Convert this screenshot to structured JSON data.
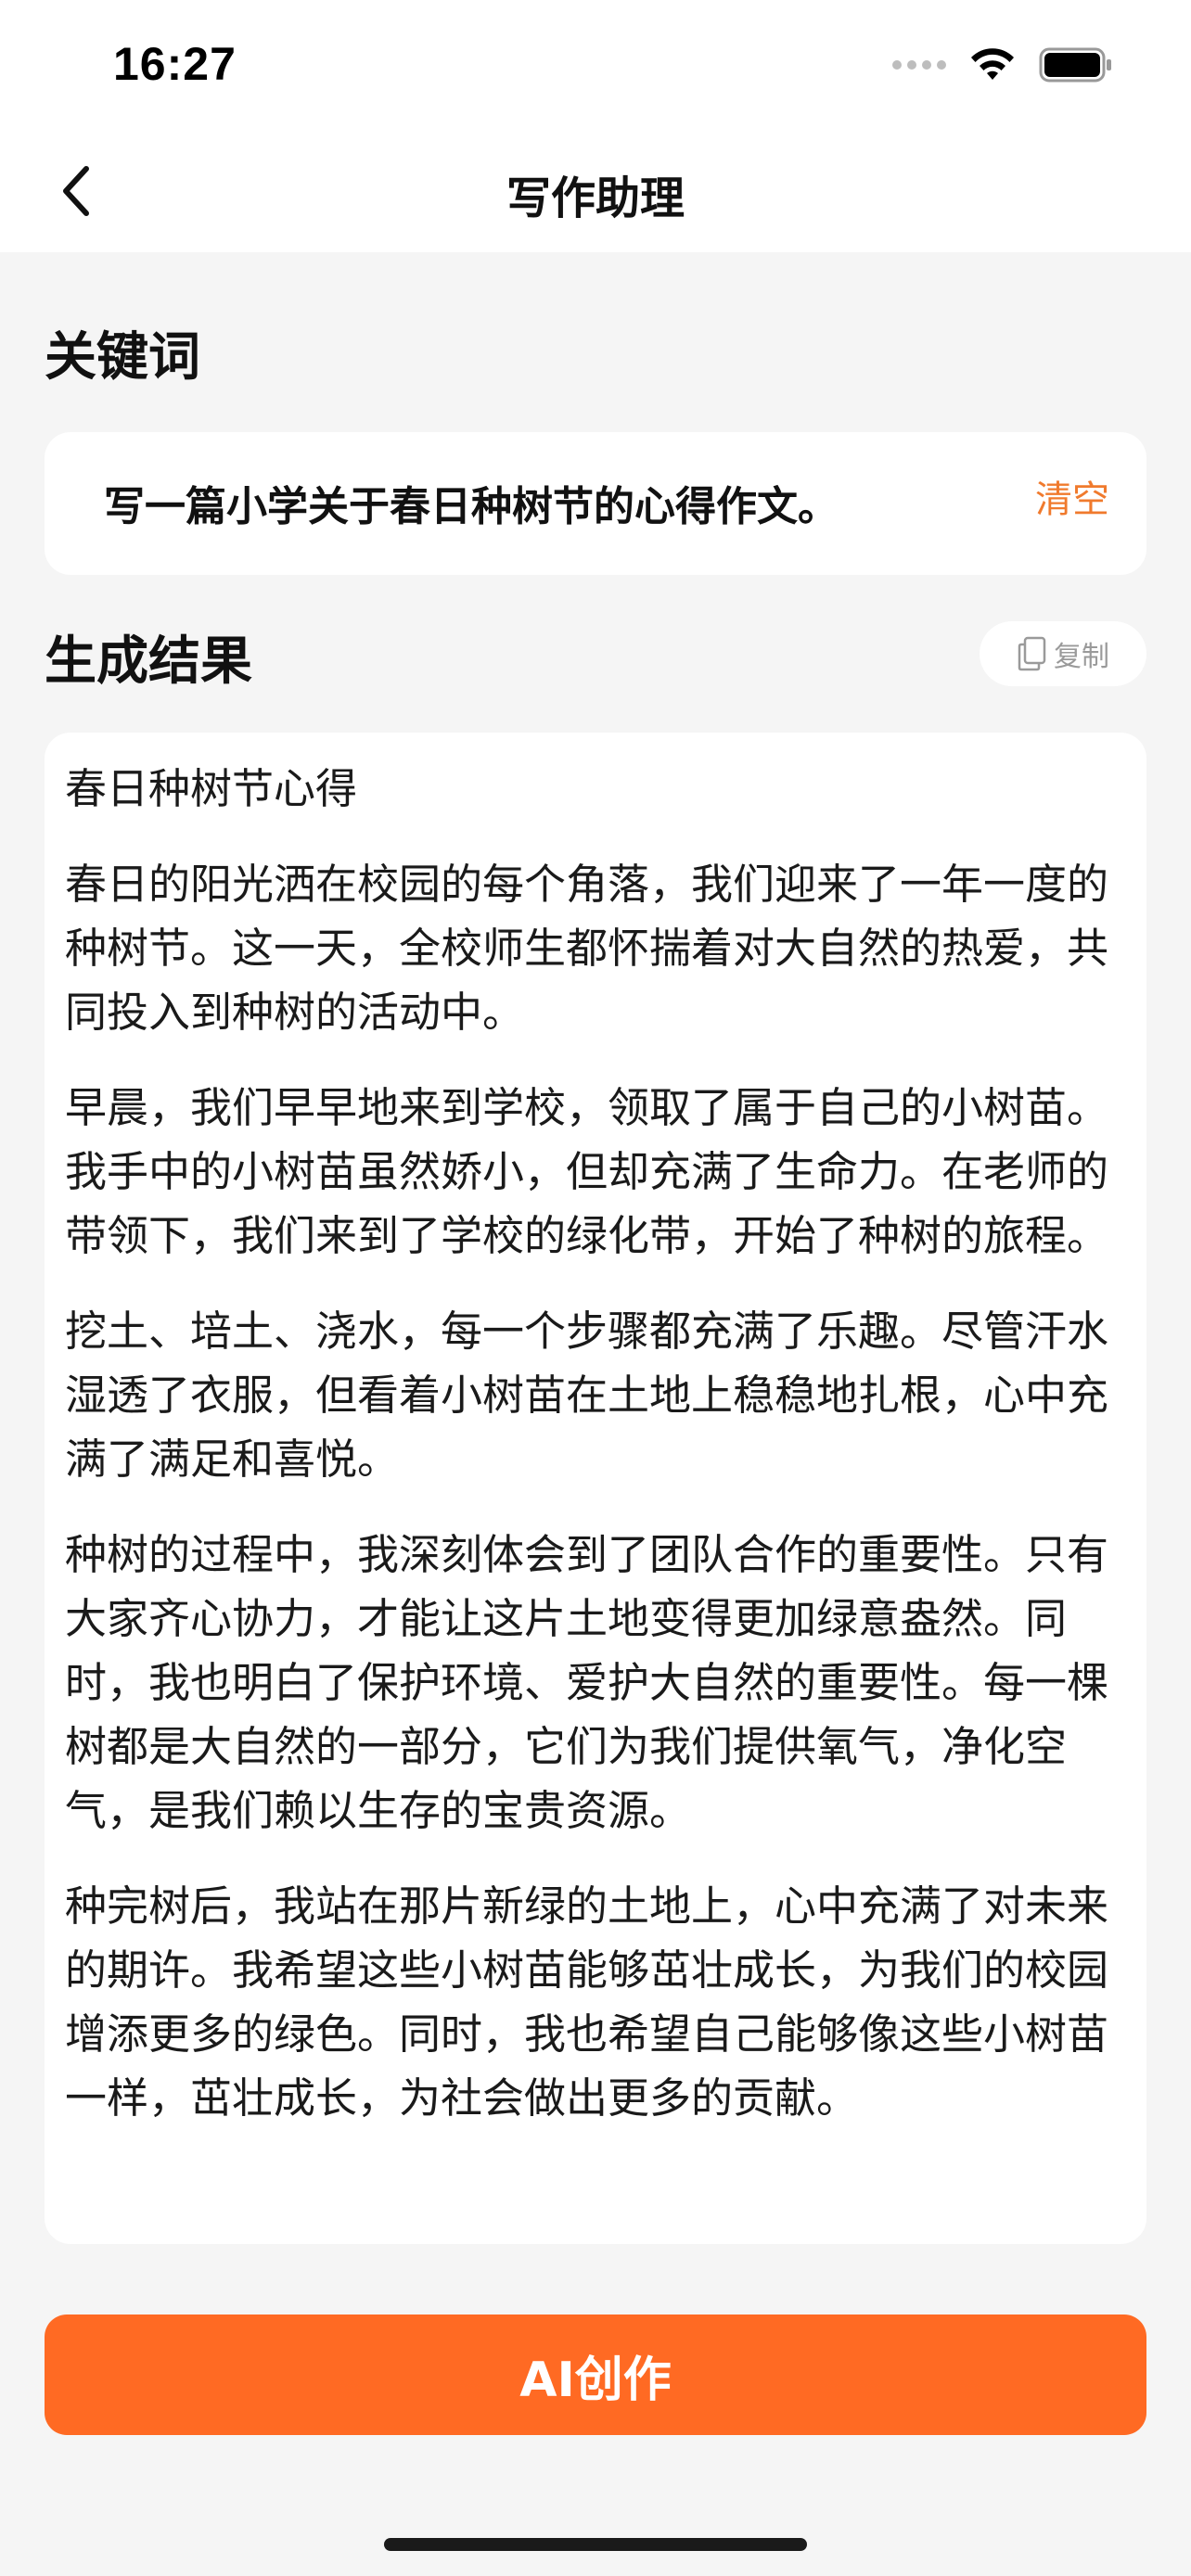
{
  "status_bar": {
    "time": "16:27"
  },
  "nav": {
    "title": "写作助理",
    "back_icon": "chevron-left-icon"
  },
  "keyword_section": {
    "title": "关键词",
    "keyword": "写一篇小学关于春日种树节的心得作文。",
    "clear_label": "清空"
  },
  "result_section": {
    "title": "生成结果",
    "copy_label": "复制",
    "copy_icon": "copy-icon",
    "paragraphs": [
      "春日种树节心得",
      "春日的阳光洒在校园的每个角落，我们迎来了一年一度的种树节。这一天，全校师生都怀揣着对大自然的热爱，共同投入到种树的活动中。",
      "早晨，我们早早地来到学校，领取了属于自己的小树苗。我手中的小树苗虽然娇小，但却充满了生命力。在老师的带领下，我们来到了学校的绿化带，开始了种树的旅程。",
      "挖土、培土、浇水，每一个步骤都充满了乐趣。尽管汗水湿透了衣服，但看着小树苗在土地上稳稳地扎根，心中充满了满足和喜悦。",
      "种树的过程中，我深刻体会到了团队合作的重要性。只有大家齐心协力，才能让这片土地变得更加绿意盎然。同时，我也明白了保护环境、爱护大自然的重要性。每一棵树都是大自然的一部分，它们为我们提供氧气，净化空气，是我们赖以生存的宝贵资源。",
      "种完树后，我站在那片新绿的土地上，心中充满了对未来的期许。我希望这些小树苗能够茁壮成长，为我们的校园增添更多的绿色。同时，我也希望自己能够像这些小树苗一样，茁壮成长，为社会做出更多的贡献。"
    ]
  },
  "action": {
    "ai_button_label": "AI创作"
  },
  "colors": {
    "accent": "#ff6a23",
    "clear_text": "#f07a2d",
    "background": "#f5f5f5"
  }
}
